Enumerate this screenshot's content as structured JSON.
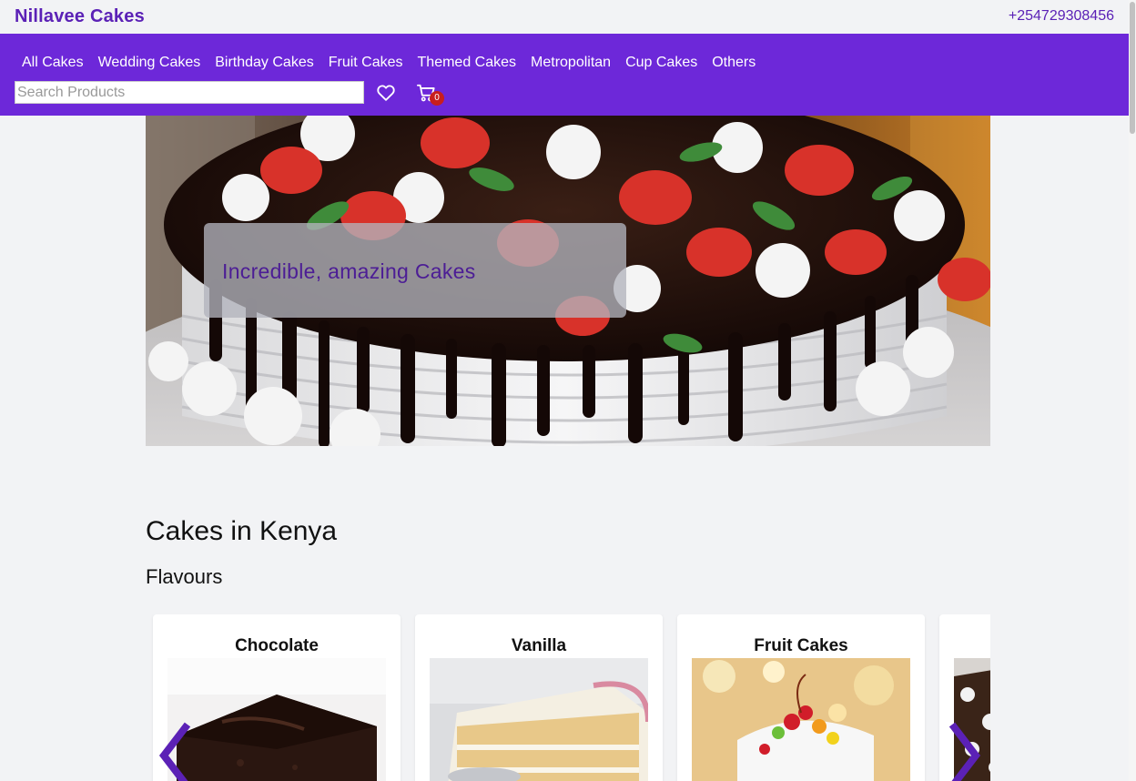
{
  "header": {
    "brand": "Nillavee Cakes",
    "phone": "+254729308456"
  },
  "nav": {
    "links": [
      "All Cakes",
      "Wedding Cakes",
      "Birthday Cakes",
      "Fruit Cakes",
      "Themed Cakes",
      "Metropolitan",
      "Cup Cakes",
      "Others"
    ],
    "search_placeholder": "Search Products",
    "search_value": "",
    "cart_count": "0",
    "icons": [
      "heart-icon",
      "cart-icon"
    ]
  },
  "hero": {
    "caption": "Incredible, amazing Cakes"
  },
  "section": {
    "title": "Cakes in Kenya",
    "subtitle": "Flavours"
  },
  "flavours": [
    {
      "title": "Chocolate"
    },
    {
      "title": "Vanilla"
    },
    {
      "title": "Fruit Cakes"
    },
    {
      "title": ""
    }
  ],
  "colors": {
    "brand": "#5b21b6",
    "navbar": "#6d28d9",
    "badge": "#c81e1e",
    "background": "#f2f3f5"
  }
}
